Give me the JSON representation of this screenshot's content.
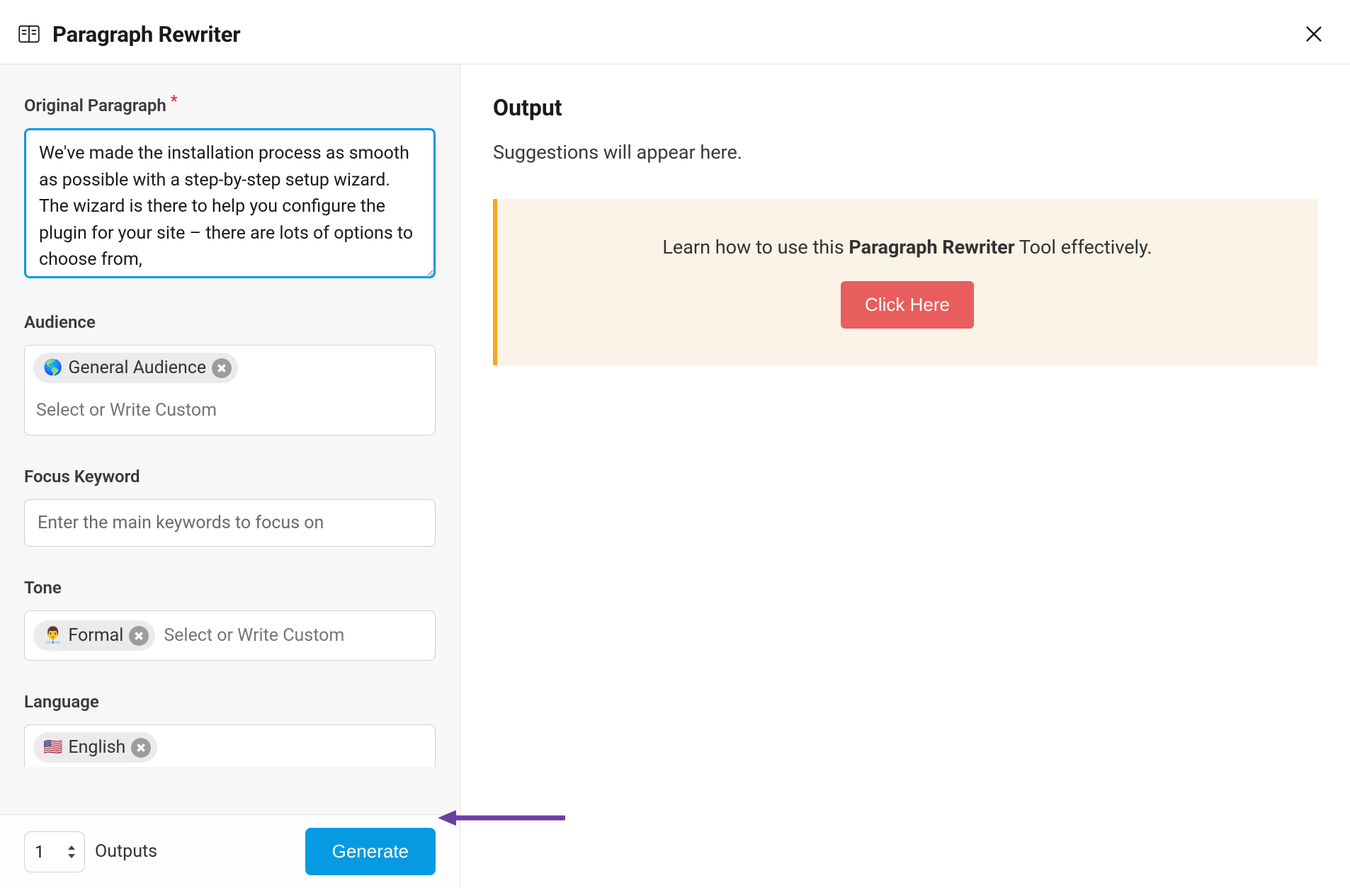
{
  "header": {
    "title": "Paragraph Rewriter"
  },
  "form": {
    "original_paragraph_label": "Original Paragraph",
    "original_paragraph_value": "We've made the installation process as smooth as possible with a step-by-step setup wizard. The wizard is there to help you configure the plugin for your site – there are lots of options to choose from,",
    "audience_label": "Audience",
    "audience_chip_emoji": "🌎",
    "audience_chip_text": "General Audience",
    "audience_placeholder": "Select or Write Custom",
    "focus_label": "Focus Keyword",
    "focus_placeholder": "Enter the main keywords to focus on",
    "tone_label": "Tone",
    "tone_chip_emoji": "👨‍💼",
    "tone_chip_text": "Formal",
    "tone_placeholder": "Select or Write Custom",
    "language_label": "Language",
    "language_chip_emoji": "🇺🇸",
    "language_chip_text": "English"
  },
  "footer": {
    "outputs_value": "1",
    "outputs_label": "Outputs",
    "generate_label": "Generate"
  },
  "output": {
    "title": "Output",
    "hint": "Suggestions will appear here.",
    "callout_pre": "Learn how to use this ",
    "callout_bold": "Paragraph Rewriter",
    "callout_post": " Tool effectively.",
    "callout_button": "Click Here"
  }
}
